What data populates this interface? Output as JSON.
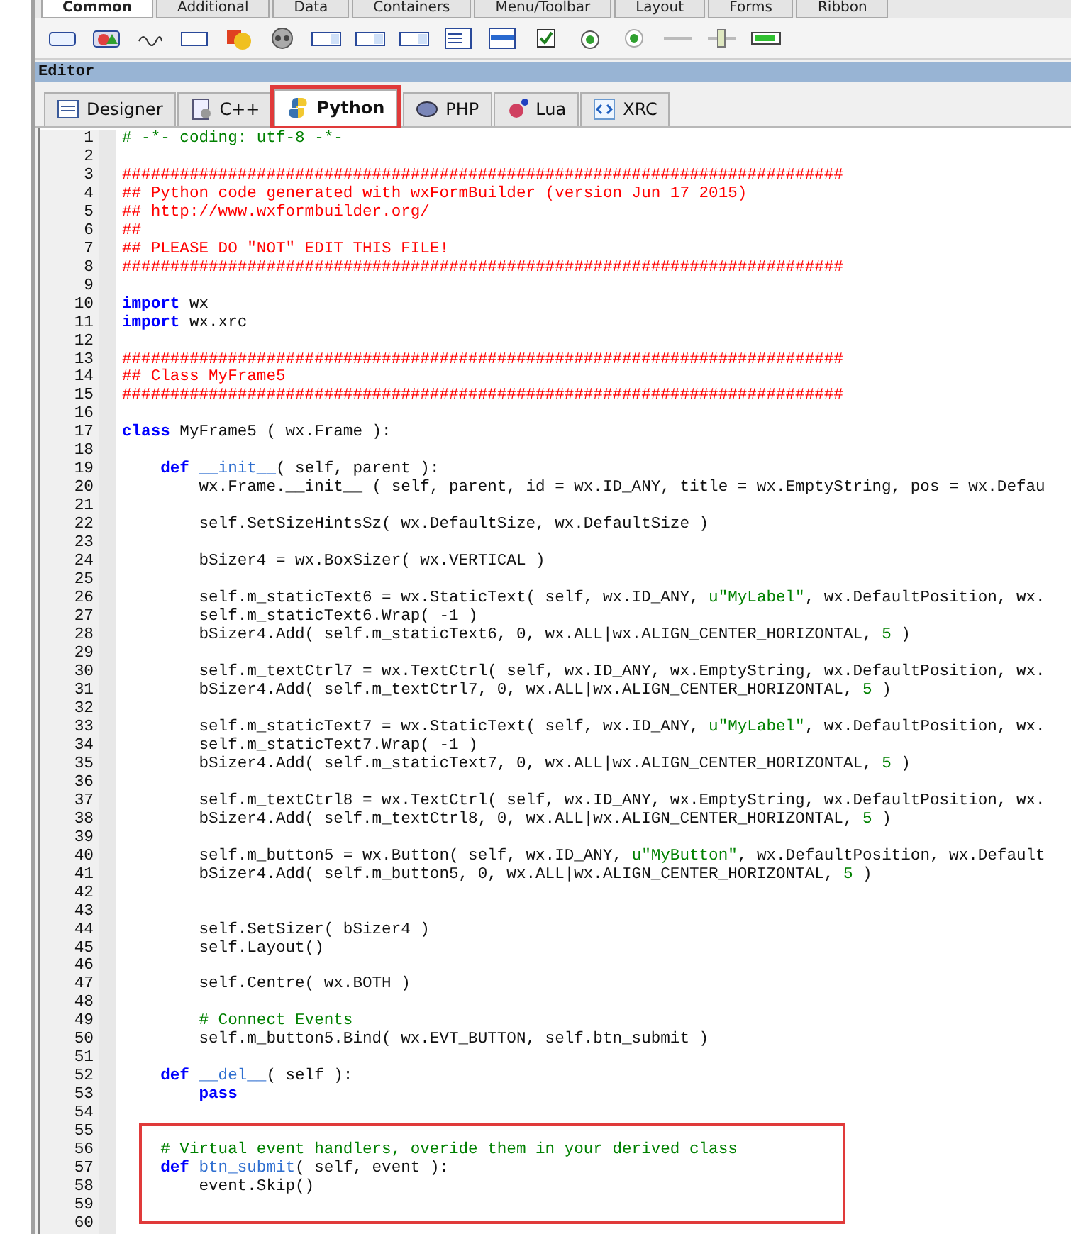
{
  "palette_tabs": [
    {
      "label": "Common",
      "selected": true
    },
    {
      "label": "Additional",
      "selected": false
    },
    {
      "label": "Data",
      "selected": false
    },
    {
      "label": "Containers",
      "selected": false
    },
    {
      "label": "Menu/Toolbar",
      "selected": false
    },
    {
      "label": "Layout",
      "selected": false
    },
    {
      "label": "Forms",
      "selected": false
    },
    {
      "label": "Ribbon",
      "selected": false
    }
  ],
  "editor": {
    "title": "Editor",
    "tabs": [
      {
        "label": "Designer",
        "kind": "designer",
        "selected": false
      },
      {
        "label": "C++",
        "kind": "cpp",
        "selected": false
      },
      {
        "label": "Python",
        "kind": "python",
        "selected": true
      },
      {
        "label": "PHP",
        "kind": "php",
        "selected": false
      },
      {
        "label": "Lua",
        "kind": "lua",
        "selected": false
      },
      {
        "label": "XRC",
        "kind": "xrc",
        "selected": false
      }
    ],
    "lines": [
      {
        "number": "1",
        "segments": [
          {
            "kind": "comment",
            "text": "# -*- coding: utf-8 -*-"
          }
        ]
      },
      {
        "number": "2"
      },
      {
        "number": "3",
        "segments": [
          {
            "kind": "banner",
            "text": "###########################################################################"
          }
        ]
      },
      {
        "number": "4",
        "segments": [
          {
            "kind": "banner",
            "text": "## Python code generated with wxFormBuilder (version Jun 17 2015)"
          }
        ]
      },
      {
        "number": "5",
        "segments": [
          {
            "kind": "banner",
            "text": "## http://www.wxformbuilder.org/"
          }
        ]
      },
      {
        "number": "6",
        "segments": [
          {
            "kind": "banner",
            "text": "##"
          }
        ]
      },
      {
        "number": "7",
        "segments": [
          {
            "kind": "banner",
            "text": "## PLEASE DO \"NOT\" EDIT THIS FILE!"
          }
        ]
      },
      {
        "number": "8",
        "segments": [
          {
            "kind": "banner",
            "text": "###########################################################################"
          }
        ]
      },
      {
        "number": "9"
      },
      {
        "number": "10",
        "segments": [
          {
            "kind": "keyword",
            "text": "import"
          },
          {
            "kind": "plain",
            "text": " wx"
          }
        ]
      },
      {
        "number": "11",
        "segments": [
          {
            "kind": "keyword",
            "text": "import"
          },
          {
            "kind": "plain",
            "text": " wx.xrc"
          }
        ]
      },
      {
        "number": "12"
      },
      {
        "number": "13",
        "segments": [
          {
            "kind": "banner",
            "text": "###########################################################################"
          }
        ]
      },
      {
        "number": "14",
        "segments": [
          {
            "kind": "banner",
            "text": "## Class MyFrame5"
          }
        ]
      },
      {
        "number": "15",
        "segments": [
          {
            "kind": "banner",
            "text": "###########################################################################"
          }
        ]
      },
      {
        "number": "16"
      },
      {
        "number": "17",
        "segments": [
          {
            "kind": "keyword",
            "text": "class"
          },
          {
            "kind": "plain",
            "text": " MyFrame5 ( wx.Frame ):"
          }
        ]
      },
      {
        "number": "18"
      },
      {
        "number": "19",
        "segments": [
          {
            "kind": "keyword",
            "text": "    def"
          },
          {
            "kind": "function",
            "text": " __init__"
          },
          {
            "kind": "plain",
            "text": "( self, parent ):"
          }
        ]
      },
      {
        "number": "20",
        "segments": [
          {
            "kind": "plain",
            "text": "        wx.Frame.__init__ ( self, parent, id = wx.ID_ANY, title = wx.EmptyString, pos = wx.Defau"
          }
        ]
      },
      {
        "number": "21"
      },
      {
        "number": "22",
        "segments": [
          {
            "kind": "plain",
            "text": "        self.SetSizeHintsSz( wx.DefaultSize, wx.DefaultSize )"
          }
        ]
      },
      {
        "number": "23"
      },
      {
        "number": "24",
        "segments": [
          {
            "kind": "plain",
            "text": "        bSizer4 = wx.BoxSizer( wx.VERTICAL )"
          }
        ]
      },
      {
        "number": "25"
      },
      {
        "number": "26",
        "segments": [
          {
            "kind": "plain",
            "text": "        self.m_staticText6 = wx.StaticText( self, wx.ID_ANY, "
          },
          {
            "kind": "string",
            "text": "u\"MyLabel\""
          },
          {
            "kind": "plain",
            "text": ", wx.DefaultPosition, wx."
          }
        ]
      },
      {
        "number": "27",
        "segments": [
          {
            "kind": "plain",
            "text": "        self.m_staticText6.Wrap( -1 )"
          }
        ]
      },
      {
        "number": "28",
        "segments": [
          {
            "kind": "plain",
            "text": "        bSizer4.Add( self.m_staticText6, 0, wx.ALL|wx.ALIGN_CENTER_HORIZONTAL, "
          },
          {
            "kind": "number",
            "text": "5"
          },
          {
            "kind": "plain",
            "text": " )"
          }
        ]
      },
      {
        "number": "29"
      },
      {
        "number": "30",
        "segments": [
          {
            "kind": "plain",
            "text": "        self.m_textCtrl7 = wx.TextCtrl( self, wx.ID_ANY, wx.EmptyString, wx.DefaultPosition, wx."
          }
        ]
      },
      {
        "number": "31",
        "segments": [
          {
            "kind": "plain",
            "text": "        bSizer4.Add( self.m_textCtrl7, 0, wx.ALL|wx.ALIGN_CENTER_HORIZONTAL, "
          },
          {
            "kind": "number",
            "text": "5"
          },
          {
            "kind": "plain",
            "text": " )"
          }
        ]
      },
      {
        "number": "32"
      },
      {
        "number": "33",
        "segments": [
          {
            "kind": "plain",
            "text": "        self.m_staticText7 = wx.StaticText( self, wx.ID_ANY, "
          },
          {
            "kind": "string",
            "text": "u\"MyLabel\""
          },
          {
            "kind": "plain",
            "text": ", wx.DefaultPosition, wx."
          }
        ]
      },
      {
        "number": "34",
        "segments": [
          {
            "kind": "plain",
            "text": "        self.m_staticText7.Wrap( -1 )"
          }
        ]
      },
      {
        "number": "35",
        "segments": [
          {
            "kind": "plain",
            "text": "        bSizer4.Add( self.m_staticText7, 0, wx.ALL|wx.ALIGN_CENTER_HORIZONTAL, "
          },
          {
            "kind": "number",
            "text": "5"
          },
          {
            "kind": "plain",
            "text": " )"
          }
        ]
      },
      {
        "number": "36"
      },
      {
        "number": "37",
        "segments": [
          {
            "kind": "plain",
            "text": "        self.m_textCtrl8 = wx.TextCtrl( self, wx.ID_ANY, wx.EmptyString, wx.DefaultPosition, wx."
          }
        ]
      },
      {
        "number": "38",
        "segments": [
          {
            "kind": "plain",
            "text": "        bSizer4.Add( self.m_textCtrl8, 0, wx.ALL|wx.ALIGN_CENTER_HORIZONTAL, "
          },
          {
            "kind": "number",
            "text": "5"
          },
          {
            "kind": "plain",
            "text": " )"
          }
        ]
      },
      {
        "number": "39"
      },
      {
        "number": "40",
        "segments": [
          {
            "kind": "plain",
            "text": "        self.m_button5 = wx.Button( self, wx.ID_ANY, "
          },
          {
            "kind": "string",
            "text": "u\"MyButton\""
          },
          {
            "kind": "plain",
            "text": ", wx.DefaultPosition, wx.Default"
          }
        ]
      },
      {
        "number": "41",
        "segments": [
          {
            "kind": "plain",
            "text": "        bSizer4.Add( self.m_button5, 0, wx.ALL|wx.ALIGN_CENTER_HORIZONTAL, "
          },
          {
            "kind": "number",
            "text": "5"
          },
          {
            "kind": "plain",
            "text": " )"
          }
        ]
      },
      {
        "number": "42"
      },
      {
        "number": "43"
      },
      {
        "number": "44",
        "segments": [
          {
            "kind": "plain",
            "text": "        self.SetSizer( bSizer4 )"
          }
        ]
      },
      {
        "number": "45",
        "segments": [
          {
            "kind": "plain",
            "text": "        self.Layout()"
          }
        ]
      },
      {
        "number": "46"
      },
      {
        "number": "47",
        "segments": [
          {
            "kind": "plain",
            "text": "        self.Centre( wx.BOTH )"
          }
        ]
      },
      {
        "number": "48"
      },
      {
        "number": "49",
        "segments": [
          {
            "kind": "comment",
            "text": "        # Connect Events"
          }
        ]
      },
      {
        "number": "50",
        "segments": [
          {
            "kind": "plain",
            "text": "        self.m_button5.Bind( wx.EVT_BUTTON, self.btn_submit )"
          }
        ]
      },
      {
        "number": "51"
      },
      {
        "number": "52",
        "segments": [
          {
            "kind": "keyword",
            "text": "    def"
          },
          {
            "kind": "function",
            "text": " __del__"
          },
          {
            "kind": "plain",
            "text": "( self ):"
          }
        ]
      },
      {
        "number": "53",
        "segments": [
          {
            "kind": "keyword",
            "text": "        pass"
          }
        ]
      },
      {
        "number": "54"
      },
      {
        "number": "55"
      },
      {
        "number": "56",
        "segments": [
          {
            "kind": "comment",
            "text": "    # Virtual event handlers, overide them in your derived class"
          }
        ]
      },
      {
        "number": "57",
        "segments": [
          {
            "kind": "keyword",
            "text": "    def"
          },
          {
            "kind": "function",
            "text": " btn_submit"
          },
          {
            "kind": "plain",
            "text": "( self, event ):"
          }
        ]
      },
      {
        "number": "58",
        "segments": [
          {
            "kind": "plain",
            "text": "        event.Skip()"
          }
        ]
      },
      {
        "number": "59"
      },
      {
        "number": "60"
      }
    ]
  }
}
